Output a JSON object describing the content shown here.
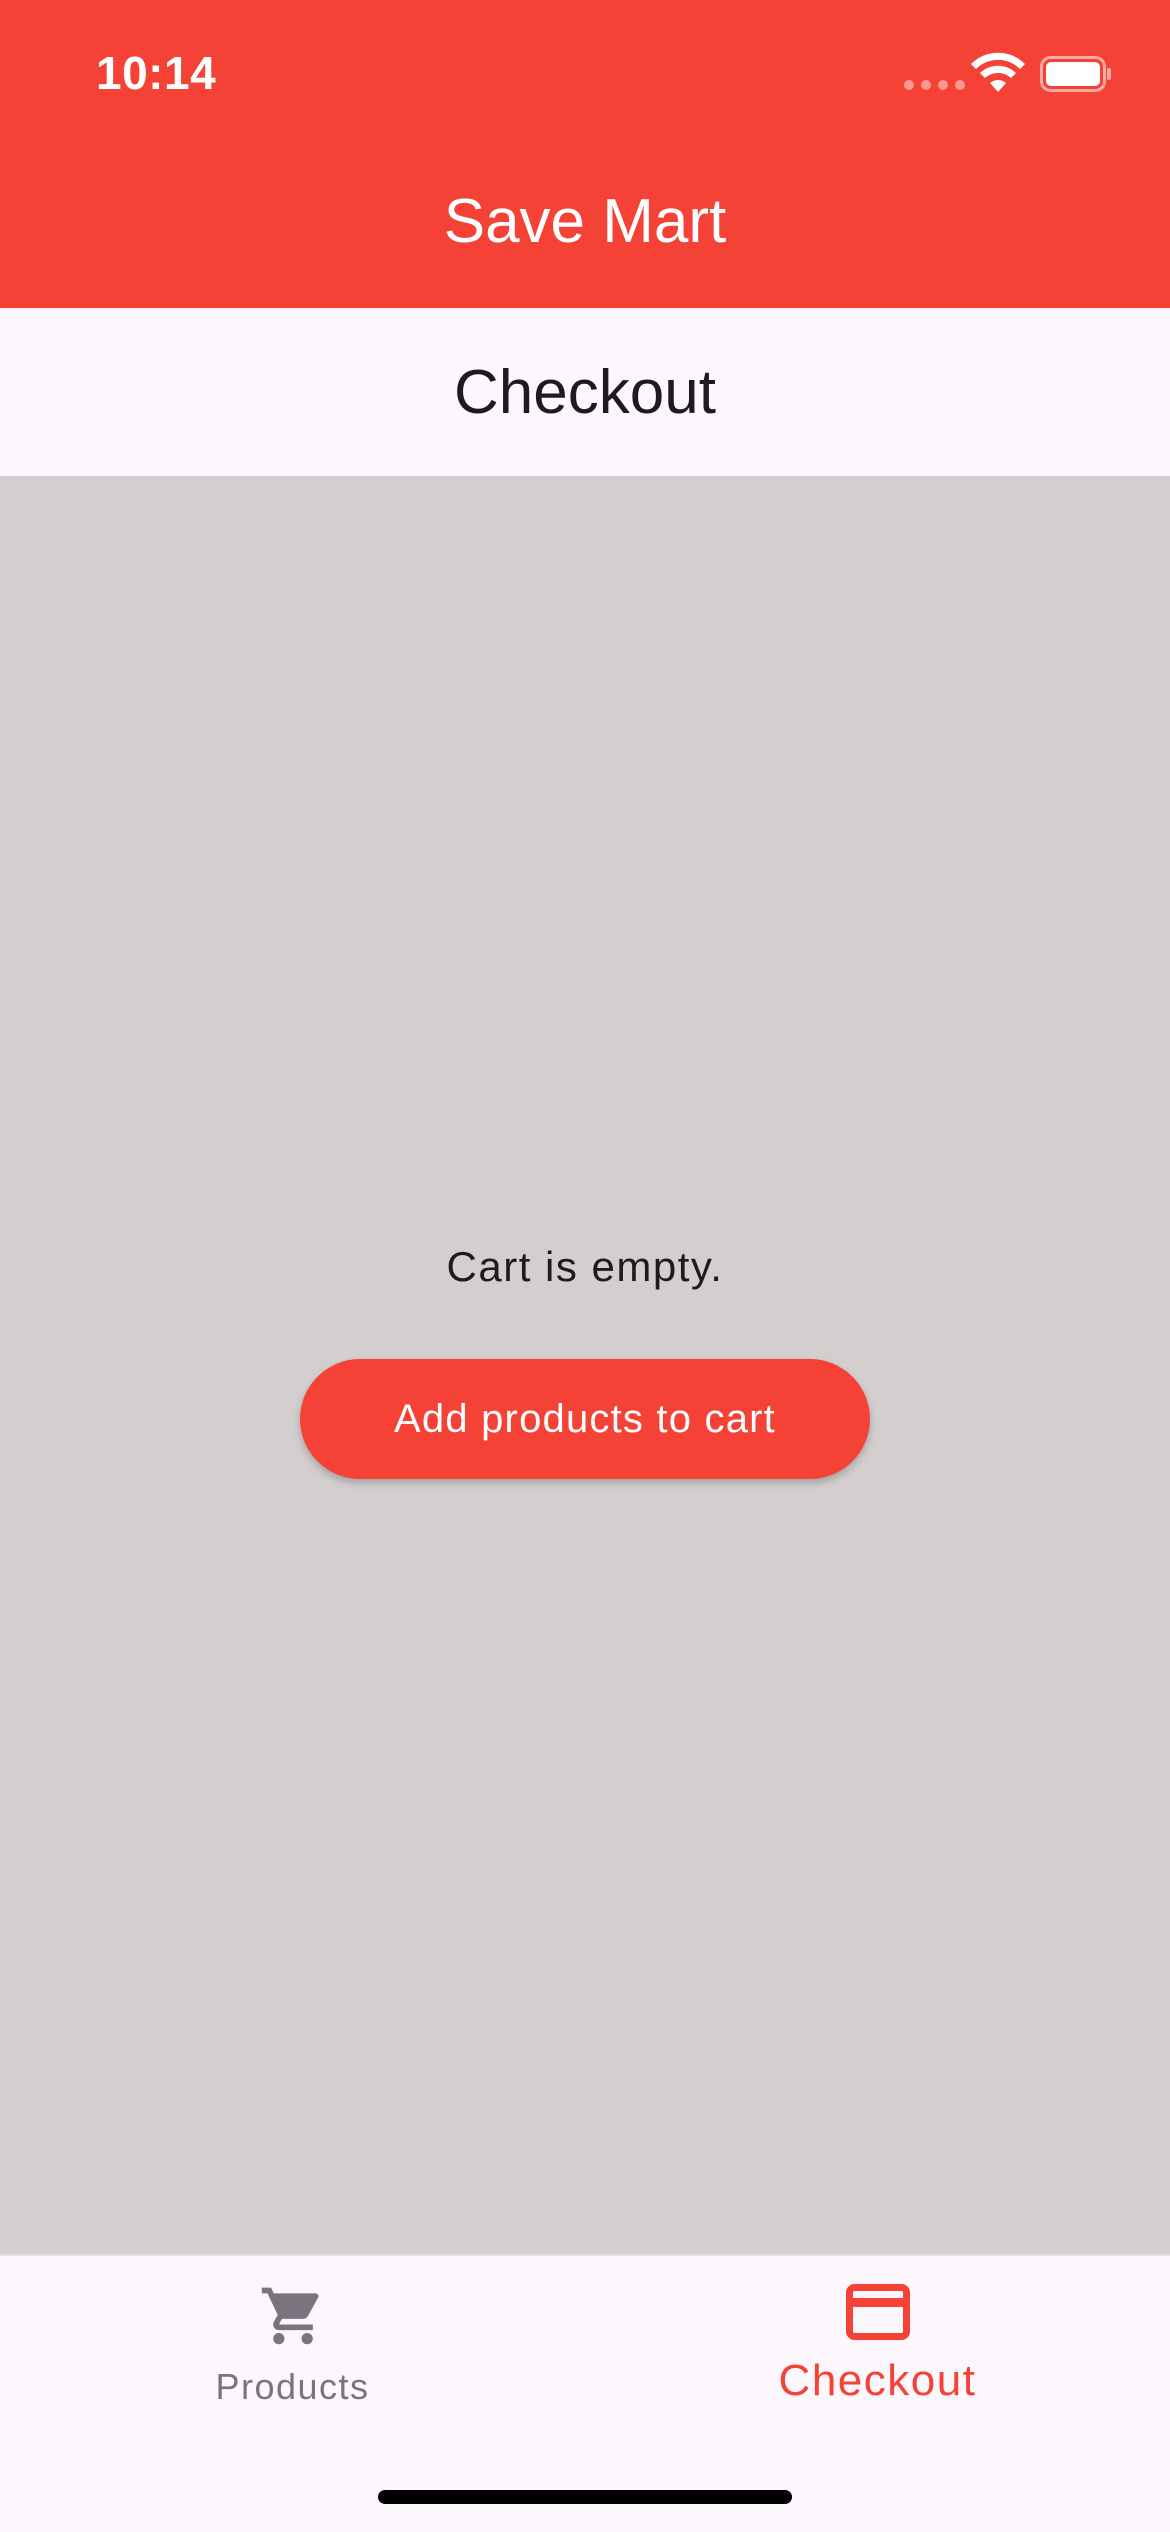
{
  "status_bar": {
    "time": "10:14",
    "signal_icon": "cellular-signal-icon",
    "wifi_icon": "wifi-icon",
    "battery_icon": "battery-icon"
  },
  "app_bar": {
    "title": "Save Mart"
  },
  "page": {
    "title": "Checkout"
  },
  "cart": {
    "empty_message": "Cart is empty.",
    "add_button_label": "Add products to cart"
  },
  "bottom_nav": {
    "items": [
      {
        "label": "Products",
        "icon": "shopping-cart-icon",
        "active": false
      },
      {
        "label": "Checkout",
        "icon": "credit-card-icon",
        "active": true
      }
    ]
  },
  "colors": {
    "primary": "#f44336",
    "surface": "#fcf7fc",
    "background": "#d2cfce",
    "inactive": "#79747e"
  }
}
